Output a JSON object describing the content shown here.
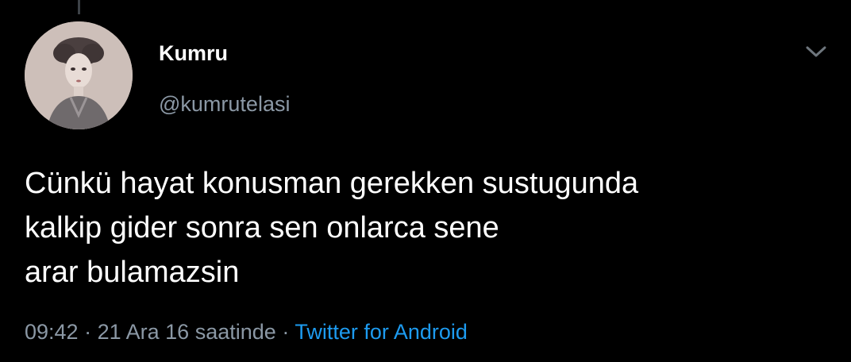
{
  "tweet": {
    "display_name": "Kumru",
    "handle": "@kumrutelasi",
    "text_lines": [
      "Cünkü hayat konusman gerekken sustugunda",
      "kalkip gider sonra sen onlarca sene",
      "arar bulamazsin"
    ],
    "time": "09:42",
    "date": "21 Ara 16 saatinde",
    "separator": "·",
    "source": "Twitter for Android"
  },
  "icons": {
    "more": "chevron-down-icon",
    "avatar": "avatar-portrait"
  },
  "colors": {
    "background": "#000000",
    "text": "#ffffff",
    "secondary_text": "#8b98a5",
    "link": "#1d9bf0"
  }
}
